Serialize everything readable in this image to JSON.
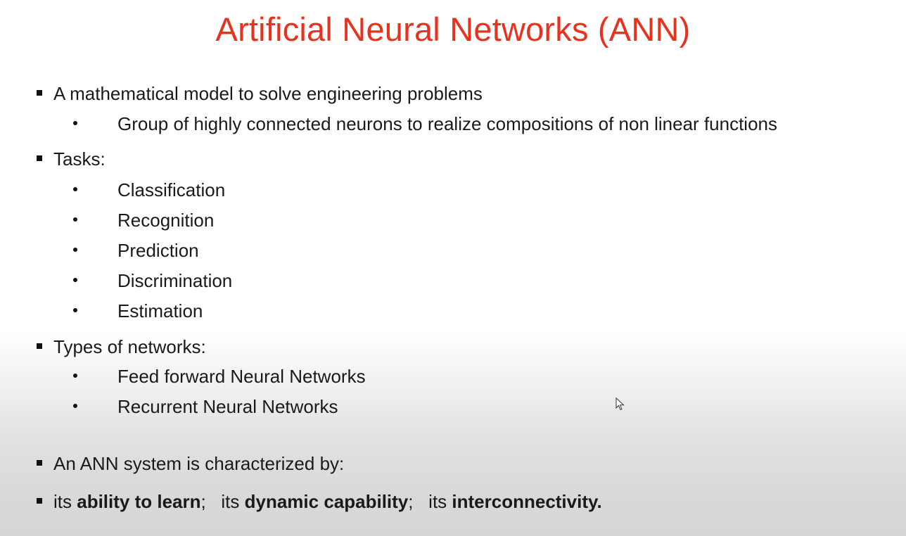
{
  "title": "Artificial Neural Networks (ANN)",
  "bullets": {
    "b1": "A mathematical model to solve engineering problems",
    "b1_sub1": "Group of highly connected neurons to realize compositions of non linear functions",
    "b2": "Tasks:",
    "tasks": [
      "Classification",
      "Recognition",
      "Prediction",
      "Discrimination",
      "Estimation"
    ],
    "b3": "Types of networks:",
    "types": [
      "Feed forward Neural Networks",
      "Recurrent Neural Networks"
    ],
    "b4": "An ANN system is characterized by:",
    "b5": {
      "p1": "its ",
      "p2": "ability to learn",
      "p3": ";   its ",
      "p4": "dynamic capability",
      "p5": ";   its ",
      "p6": "interconnectivity."
    }
  },
  "icons": {
    "cursor": "mouse-pointer-icon"
  },
  "colors": {
    "title": "#e8321e",
    "text": "#1a1a1a"
  }
}
